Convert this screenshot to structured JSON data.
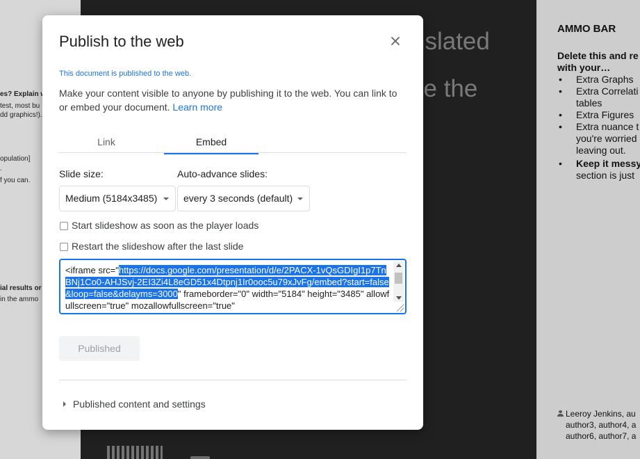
{
  "background": {
    "left_fragments": [
      {
        "text": "es? Explain w",
        "bold": true
      },
      {
        "text": "test, most bu",
        "bold": false
      },
      {
        "text": "dd graphics!).",
        "bold": false
      },
      {
        "text": "opulation]",
        "bold": false
      },
      {
        "text": ".",
        "bold": false
      },
      {
        "text": "f you can.",
        "bold": false
      },
      {
        "text": "ial results or",
        "bold": true
      },
      {
        "text": " in the ammo",
        "bold": false
      }
    ],
    "slide_text_1": "nslated",
    "slide_text_2": "ze the",
    "ammo_bar": {
      "title": "AMMO BAR",
      "heading_line1": "Delete this and re",
      "heading_line2": "with your…",
      "items": [
        {
          "lines": [
            "Extra Graphs"
          ],
          "bold": false
        },
        {
          "lines": [
            "Extra Correlati",
            "tables"
          ],
          "bold": false
        },
        {
          "lines": [
            "Extra Figures"
          ],
          "bold": false
        },
        {
          "lines": [
            "Extra nuance t",
            "you're worried",
            "leaving out."
          ],
          "bold": false
        },
        {
          "lines": [
            "Keep it messy",
            "section is just"
          ],
          "bold": true
        }
      ],
      "authors_line1": "Leeroy Jenkins, au",
      "authors_line2": "author3, author4, a",
      "authors_line3": "author6, author7, a"
    }
  },
  "dialog": {
    "title": "Publish to the web",
    "close_icon": "close-icon",
    "published_note": "This document is published to the web.",
    "description": "Make your content visible to anyone by publishing it to the web. You can link to or embed your document.",
    "learn_more": "Learn more",
    "tabs": [
      {
        "label": "Link",
        "active": false
      },
      {
        "label": "Embed",
        "active": true
      }
    ],
    "slide_size_label": "Slide size:",
    "slide_size_value": "Medium (5184x3485)",
    "auto_advance_label": "Auto-advance slides:",
    "auto_advance_value": "every 3 seconds (default)",
    "checkbox_start": {
      "label": "Start slideshow as soon as the player loads",
      "checked": false
    },
    "checkbox_restart": {
      "label": "Restart the slideshow after the last slide",
      "checked": false
    },
    "embed_code": {
      "prefix": "<iframe src=\"",
      "url": "https://docs.google.com/presentation/d/e/2PACX-1vQsGDIgI1p7TnBNj1Co0-AHJSvj-2EI3Zi4L8eGD51x4Dtpnj1Ir0ooc5u79xJvFg/embed?start=false&loop=false&delayms=3000",
      "suffix": "\" frameborder=\"0\" width=\"5184\" height=\"3485\" allowfullscreen=\"true\" mozallowfullscreen=\"true\""
    },
    "published_button": "Published",
    "published_settings": "Published content and settings"
  },
  "colors": {
    "accent": "#1a73e8",
    "overlay_left": "#d7d7d7",
    "slide_bg": "#202020"
  }
}
